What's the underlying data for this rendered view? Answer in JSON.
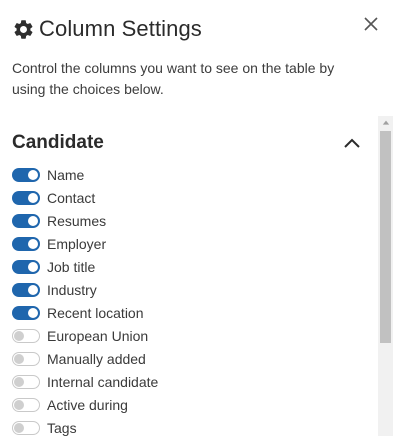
{
  "dialog": {
    "title": "Column Settings",
    "description": "Control the columns you want to see on the table by using the choices below."
  },
  "section": {
    "title": "Candidate"
  },
  "columns": [
    {
      "label": "Name",
      "enabled": true
    },
    {
      "label": "Contact",
      "enabled": true
    },
    {
      "label": "Resumes",
      "enabled": true
    },
    {
      "label": "Employer",
      "enabled": true
    },
    {
      "label": "Job title",
      "enabled": true
    },
    {
      "label": "Industry",
      "enabled": true
    },
    {
      "label": "Recent location",
      "enabled": true
    },
    {
      "label": "European Union",
      "enabled": false
    },
    {
      "label": "Manually added",
      "enabled": false
    },
    {
      "label": "Internal candidate",
      "enabled": false
    },
    {
      "label": "Active during",
      "enabled": false
    },
    {
      "label": "Tags",
      "enabled": false
    }
  ],
  "icons": {
    "header": "gear-icon",
    "close": "close-icon",
    "collapse": "chevron-up-icon",
    "scroll_up": "arrow-up-icon"
  },
  "colors": {
    "toggle_on": "#1f66ad",
    "toggle_off_border": "#c9c9c9",
    "text": "#333333"
  }
}
